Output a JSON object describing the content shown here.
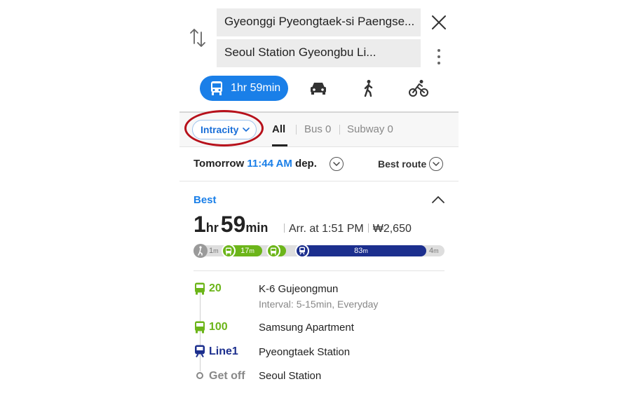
{
  "search": {
    "origin": "Gyeonggi Pyeongtaek-si Paengse...",
    "destination": "Seoul Station Gyeongbu Li..."
  },
  "modes": {
    "transit_time": "1hr 59min"
  },
  "filters": {
    "intracity_label": "Intracity",
    "tabs": [
      {
        "label": "All"
      },
      {
        "label": "Bus 0"
      },
      {
        "label": "Subway 0"
      }
    ]
  },
  "departure": {
    "day": "Tomorrow",
    "time": "11:44 AM",
    "suffix": "dep.",
    "sort_label": "Best route"
  },
  "route": {
    "badge": "Best",
    "hours": "1",
    "hours_unit": "hr",
    "minutes": "59",
    "minutes_unit": "min",
    "arrival": "Arr. at 1:51 PM",
    "fare": "₩2,650",
    "timeline": {
      "walk_start_min": "1",
      "bus_min": "17",
      "subway_min": "83",
      "walk_end_min": "4",
      "unit": "m"
    },
    "steps": [
      {
        "line": "20",
        "stop": "K-6 Gujeongmun",
        "sub": "Interval: 5-15min, Everyday",
        "color": "#6cb51a"
      },
      {
        "line": "100",
        "stop": "Samsung Apartment",
        "color": "#6cb51a"
      },
      {
        "line": "Line1",
        "stop": "Pyeongtaek Station",
        "color": "#1c2f8e"
      },
      {
        "line": "Get off",
        "stop": "Seoul Station",
        "color": "#888888"
      }
    ]
  },
  "colors": {
    "accent": "#1a7fe8",
    "bus_green": "#6cb51a",
    "line1_navy": "#1c2f8e",
    "highlight": "#b7111b"
  }
}
